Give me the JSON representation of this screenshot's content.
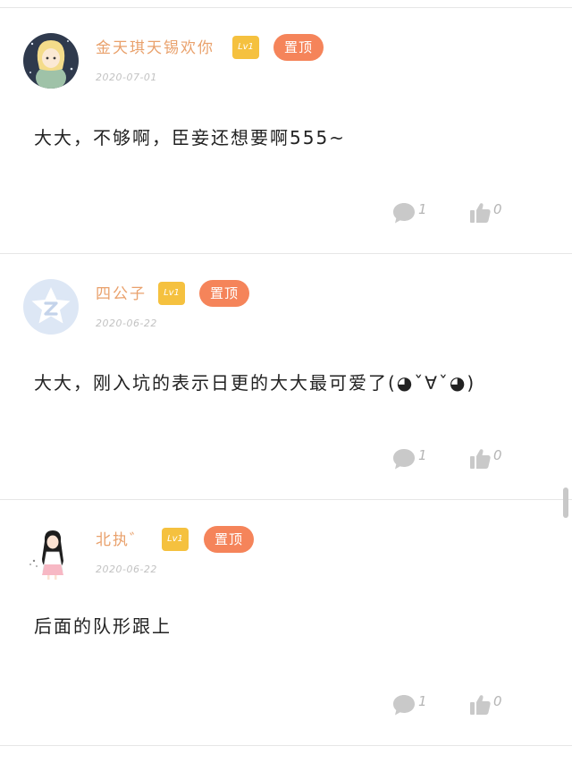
{
  "comments": [
    {
      "username": "金天琪天锡欢你",
      "level": "Lv1",
      "pin_label": "置顶",
      "date": "2020-07-01",
      "content": "大大，不够啊，臣妾还想要啊555~",
      "reply_count": "1",
      "like_count": "0"
    },
    {
      "username": "四公子",
      "level": "Lv1",
      "pin_label": "置顶",
      "date": "2020-06-22",
      "content": "大大，刚入坑的表示日更的大大最可爱了(◕ˇ∀ˇ◕)",
      "reply_count": "1",
      "like_count": "0"
    },
    {
      "username": "北执゛",
      "level": "Lv1",
      "pin_label": "置顶",
      "date": "2020-06-22",
      "content": "后面的队形跟上",
      "reply_count": "1",
      "like_count": "0"
    }
  ],
  "icons": {
    "reply": "comment-bubble-icon",
    "like": "thumbs-up-icon"
  },
  "colors": {
    "username": "#e9a16c",
    "level_badge": "#f5c13f",
    "pin_badge": "#f5845a",
    "date": "#c2c2c2",
    "icon": "#c9c9c9"
  }
}
